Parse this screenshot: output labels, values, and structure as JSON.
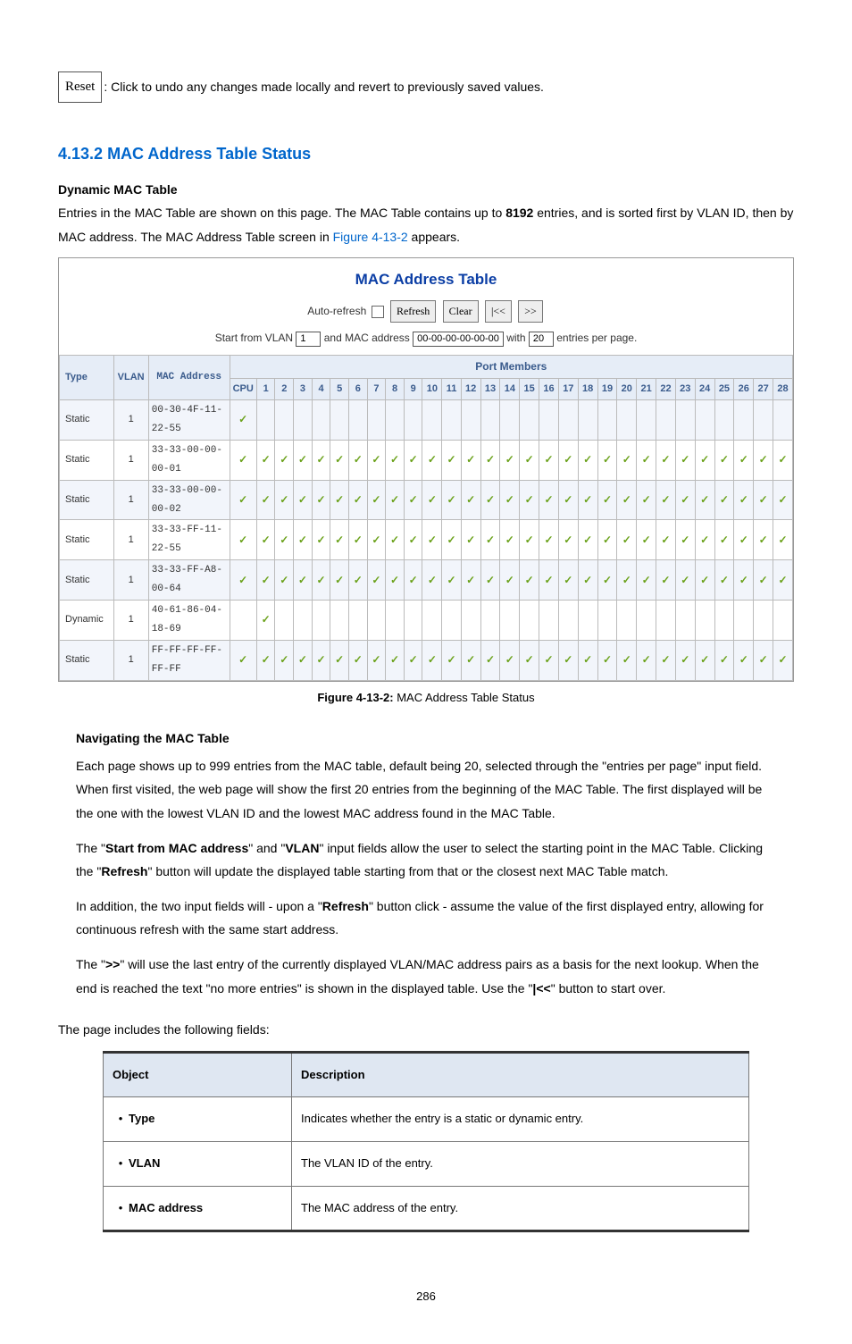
{
  "reset": {
    "button_label": "Reset",
    "description": ": Click to undo any changes made locally and revert to previously saved values."
  },
  "section": {
    "number": "4.13.2",
    "title": "MAC Address Table Status",
    "sub": "Dynamic MAC Table"
  },
  "intro": {
    "part1": "Entries in the MAC Table are shown on this page. The MAC Table contains up to ",
    "count": "8192",
    "part2": " entries, and is sorted first by VLAN ID, then by MAC address. The MAC Address Table screen in ",
    "figref": "Figure 4-13-2",
    "part3": " appears."
  },
  "shot": {
    "title": "MAC Address Table",
    "auto_refresh_label": "Auto-refresh",
    "buttons": {
      "refresh": "Refresh",
      "clear": "Clear",
      "first": "|<<",
      "next": ">>"
    },
    "row2": {
      "start_from": "Start from VLAN",
      "vlan_value": "1",
      "and_mac": "and MAC address",
      "mac_value": "00-00-00-00-00-00",
      "with": "with",
      "count_value": "20",
      "entries": "entries per page."
    },
    "headers": {
      "type": "Type",
      "vlan": "VLAN",
      "mac": "MAC Address",
      "port_members": "Port Members",
      "cpu": "CPU"
    },
    "port_count": 28,
    "rows": [
      {
        "type": "Static",
        "vlan": "1",
        "mac": "00-30-4F-11-22-55",
        "cpu": true,
        "ports": "none"
      },
      {
        "type": "Static",
        "vlan": "1",
        "mac": "33-33-00-00-00-01",
        "cpu": true,
        "ports": "all"
      },
      {
        "type": "Static",
        "vlan": "1",
        "mac": "33-33-00-00-00-02",
        "cpu": true,
        "ports": "all"
      },
      {
        "type": "Static",
        "vlan": "1",
        "mac": "33-33-FF-11-22-55",
        "cpu": true,
        "ports": "all"
      },
      {
        "type": "Static",
        "vlan": "1",
        "mac": "33-33-FF-A8-00-64",
        "cpu": true,
        "ports": "all"
      },
      {
        "type": "Dynamic",
        "vlan": "1",
        "mac": "40-61-86-04-18-69",
        "cpu": false,
        "ports": [
          1
        ]
      },
      {
        "type": "Static",
        "vlan": "1",
        "mac": "FF-FF-FF-FF-FF-FF",
        "cpu": true,
        "ports": "all"
      }
    ]
  },
  "figcaption": {
    "strong": "Figure 4-13-2:",
    "rest": " MAC Address Table Status"
  },
  "navigating": {
    "heading": "Navigating the MAC Table",
    "p1a": "Each page shows up to 999 entries from the MAC table, default being 20, selected through the \"",
    "p1b": "entries per page\"",
    "p1c": " input field. When first visited, the web page will show the first 20 entries from the beginning of the MAC Table. The first displayed will be the one with the lowest VLAN ID and the lowest MAC address found in the MAC Table.",
    "p2a": "The \"",
    "p2b": "Start from MAC address",
    "p2c": "\" and \"",
    "p2d": "VLAN",
    "p2e": "\" input fields allow the user to select the starting point in the MAC Table. Clicking the \"",
    "p2f": "Refresh",
    "p2g": "\" button will update the displayed table starting from that or the closest next MAC Table match.",
    "p3a": "In addition, the two input fields will - upon a \"",
    "p3b": "Refresh",
    "p3c": "\" button click - assume the value of the first displayed entry, allowing for continuous refresh with the same start address.",
    "p4a": "The \"",
    "p4b": ">>",
    "p4c": "\" will use the last entry of the currently displayed VLAN/MAC address pairs as a basis for the next lookup. When the end is reached the text \"no more entries\" is shown in the displayed table. Use the \"",
    "p4d": "|<<",
    "p4e": "\" button to start over."
  },
  "fields": {
    "intro": "The page includes the following fields:",
    "header_obj": "Object",
    "header_desc": "Description",
    "rows": [
      {
        "obj": "Type",
        "desc": "Indicates whether the entry is a static or dynamic entry."
      },
      {
        "obj": "VLAN",
        "desc": "The VLAN ID of the entry."
      },
      {
        "obj": "MAC address",
        "desc": "The MAC address of the entry."
      }
    ]
  },
  "pagenum": "286"
}
